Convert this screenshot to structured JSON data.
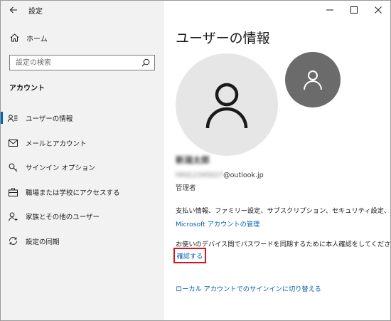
{
  "window": {
    "app_title": "設定",
    "minimize_glyph": "—",
    "maximize_glyph": "☐",
    "close_glyph": "✕"
  },
  "sidebar": {
    "home_label": "ホーム",
    "search_placeholder": "設定の検索",
    "section_heading": "アカウント",
    "items": [
      {
        "label": "ユーザーの情報",
        "icon": "user-info-icon",
        "active": true
      },
      {
        "label": "メールとアカウント",
        "icon": "mail-icon",
        "active": false
      },
      {
        "label": "サインイン オプション",
        "icon": "key-icon",
        "active": false
      },
      {
        "label": "職場または学校にアクセスする",
        "icon": "briefcase-icon",
        "active": false
      },
      {
        "label": "家族とその他のユーザー",
        "icon": "person-add-icon",
        "active": false
      },
      {
        "label": "設定の同期",
        "icon": "sync-icon",
        "active": false
      }
    ]
  },
  "main": {
    "page_title": "ユーザーの情報",
    "user_name": "新潟太郎",
    "email_local": "f4fd12345027",
    "email_domain": "@outlook.jp",
    "role": "管理者",
    "info_text": "支払い情報、ファミリー設定、サブスクリプション、セキュリティ設定、その他",
    "ms_account_link": "Microsoft アカウントの管理",
    "sync_text": "お使いのデバイス間でパスワードを同期するために本人確認をしてください。",
    "verify_link": "確認する",
    "local_account_link": "ローカル アカウントでのサインインに切り替える"
  },
  "colors": {
    "accent": "#0063b1",
    "highlight_box": "#d9141f",
    "sidebar_bg": "#f2f2f2"
  }
}
